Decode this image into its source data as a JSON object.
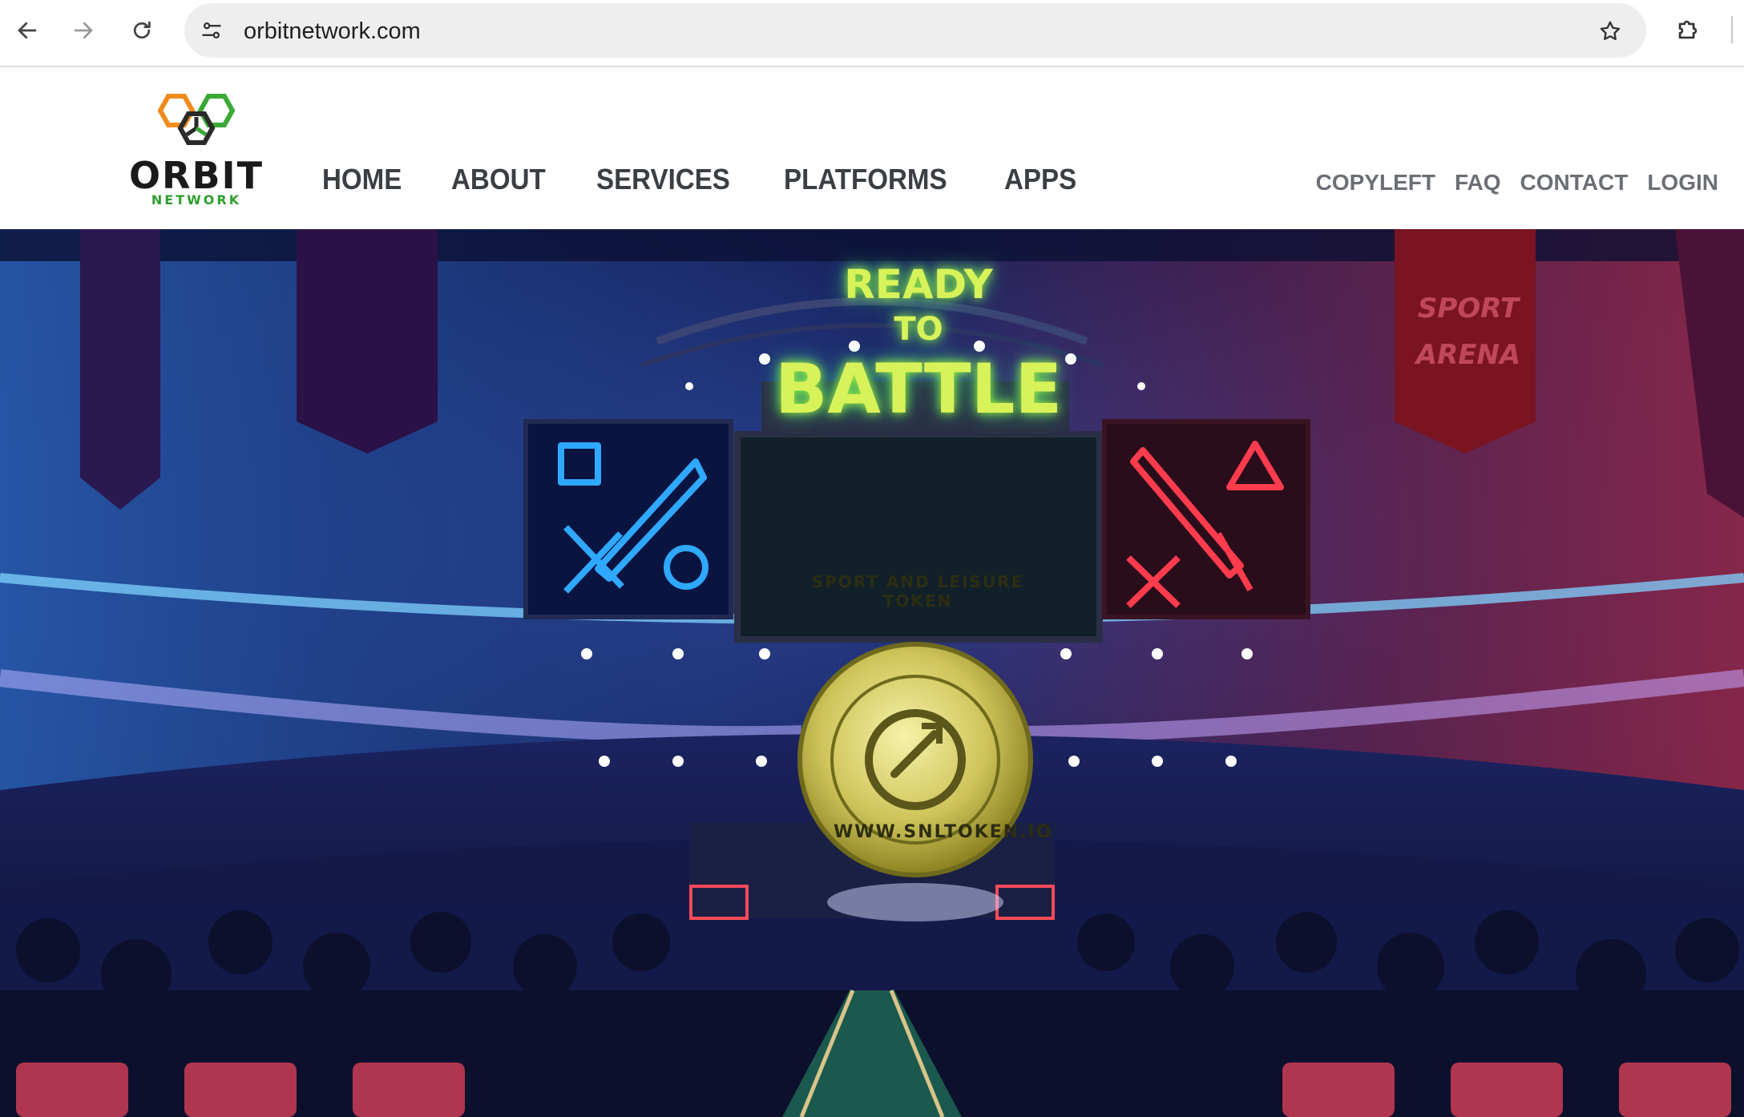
{
  "browser": {
    "url": "orbitnetwork.com",
    "icons": {
      "back": "arrow-left-icon",
      "forward": "arrow-right-icon",
      "reload": "reload-icon",
      "site_info": "tune-icon",
      "bookmark": "star-icon",
      "extensions": "puzzle-icon"
    }
  },
  "header": {
    "logo": {
      "word": "ORBIT",
      "sub": "NETWORK"
    },
    "main_nav": [
      "HOME",
      "ABOUT",
      "SERVICES",
      "PLATFORMS",
      "APPS"
    ],
    "util_nav": [
      "COPYLEFT",
      "FAQ",
      "CONTACT",
      "LOGIN"
    ]
  },
  "hero": {
    "screen_line1": "READY",
    "screen_line2": "TO",
    "screen_line3": "BATTLE",
    "banner_text": [
      "SPORT",
      "ARENA"
    ],
    "coin_top": "SPORT AND LEISURE TOKEN",
    "coin_bottom": "WWW.SNLTOKEN.IO",
    "colors": {
      "left_screen": "#2fa8ff",
      "center_screen": "#d8f25a",
      "right_screen": "#ff3b4e"
    }
  }
}
